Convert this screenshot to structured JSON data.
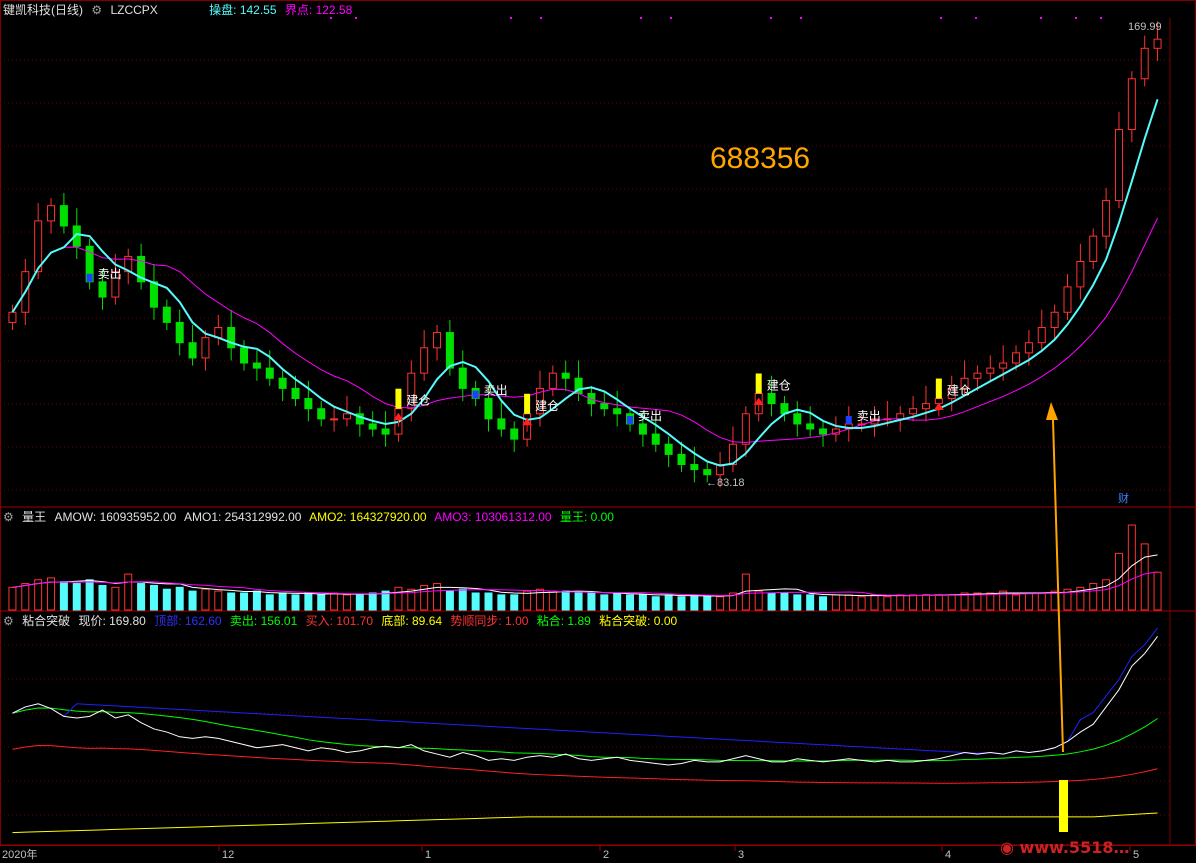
{
  "header": {
    "stock": "键凯科技(日线)",
    "indicator": "LZCCPX",
    "caopan_label": "操盘",
    "caopan_value": "142.55",
    "jiedian_label": "界点",
    "jiedian_value": "122.58"
  },
  "vol_header": {
    "name": "量王",
    "amow": "AMOW: 160935952.00",
    "amo1": "AMO1: 254312992.00",
    "amo2": "AMO2: 164327920.00",
    "amo3": "AMO3: 103061312.00",
    "lw": "量王: 0.00"
  },
  "ind_header": {
    "name": "粘合突破",
    "xj": "现价: 169.80",
    "dingbu": "顶部: 162.60",
    "maichu": "卖出: 156.01",
    "mairu": "买入: 101.70",
    "dibu": "底部: 89.64",
    "shishun": "势顺同步: 1.00",
    "nianhe": "粘合: 1.89",
    "nhtp": "粘合突破: 0.00"
  },
  "annotations": {
    "code": "688356",
    "high_label": "169.99",
    "low_label": "←83.18",
    "cai": "财",
    "signals": [
      {
        "text": "卖出",
        "color": "#00ff00",
        "idx": 6
      },
      {
        "text": "建仓",
        "color": "#ffff00",
        "idx": 30
      },
      {
        "text": "卖出",
        "color": "#00ff00",
        "idx": 36
      },
      {
        "text": "建仓",
        "color": "#ffff00",
        "idx": 40
      },
      {
        "text": "卖出",
        "color": "#00ff00",
        "idx": 48
      },
      {
        "text": "建仓",
        "color": "#ffff00",
        "idx": 58
      },
      {
        "text": "卖出",
        "color": "#00ff00",
        "idx": 65
      },
      {
        "text": "建仓",
        "color": "#ffff00",
        "idx": 72
      }
    ]
  },
  "x_axis": [
    "2020年",
    "12",
    "1",
    "2",
    "3",
    "4",
    "5"
  ],
  "colors": {
    "up": "#ff3232",
    "down": "#54fcfc",
    "greenDown": "#00e000",
    "ma_short": "#54fcfc",
    "ma_long": "#ff00ff"
  },
  "chart_data": {
    "type": "candlestick",
    "y_range": [
      80,
      172
    ],
    "closes": [
      116,
      124,
      134,
      137,
      133,
      129,
      122,
      119,
      124,
      127,
      122,
      117,
      114,
      110,
      107,
      111,
      113,
      109,
      106,
      105,
      103,
      101,
      99,
      97,
      95,
      95,
      96,
      94,
      93,
      92,
      97,
      104,
      109,
      112,
      105,
      101,
      99,
      95,
      93,
      91,
      96,
      101,
      104,
      103,
      100,
      98,
      97,
      96,
      94,
      92,
      90,
      88,
      86,
      85,
      84,
      86,
      90,
      96,
      100,
      98,
      96,
      94,
      93,
      92,
      93,
      94,
      94,
      95,
      95,
      96,
      97,
      98,
      99,
      101,
      103,
      104,
      105,
      106,
      108,
      110,
      113,
      116,
      121,
      126,
      131,
      138,
      152,
      162,
      168,
      169.8
    ],
    "amo_volumes": [
      1.2,
      1.4,
      1.6,
      1.7,
      1.5,
      1.4,
      1.6,
      1.3,
      1.2,
      1.9,
      1.4,
      1.3,
      1.1,
      1.2,
      1.0,
      1.1,
      1.0,
      0.9,
      0.9,
      1.0,
      0.8,
      0.9,
      0.8,
      0.9,
      0.8,
      0.9,
      0.8,
      0.8,
      0.9,
      1.0,
      1.2,
      1.1,
      1.3,
      1.4,
      1.0,
      1.1,
      0.9,
      0.9,
      0.8,
      0.8,
      1.0,
      1.1,
      1.0,
      1.0,
      0.9,
      0.9,
      0.8,
      0.9,
      0.8,
      0.8,
      0.7,
      0.8,
      0.7,
      0.8,
      0.7,
      0.7,
      0.9,
      1.9,
      1.0,
      0.9,
      0.9,
      0.8,
      0.8,
      0.7,
      0.8,
      0.8,
      0.7,
      0.8,
      0.7,
      0.8,
      0.8,
      0.8,
      0.8,
      0.8,
      0.9,
      0.9,
      0.9,
      1.0,
      0.8,
      0.9,
      0.9,
      1.0,
      1.1,
      1.2,
      1.4,
      1.6,
      3.0,
      4.5,
      3.5,
      2.0
    ],
    "white": [
      82,
      86,
      88,
      85,
      80,
      79,
      80,
      84,
      79,
      81,
      76,
      72,
      70,
      67,
      66,
      67,
      66,
      64,
      62,
      60,
      61,
      62,
      60,
      58,
      60,
      59,
      57,
      58,
      60,
      61,
      60,
      62,
      58,
      56,
      54,
      57,
      55,
      52,
      53,
      52,
      54,
      55,
      54,
      56,
      53,
      52,
      53,
      54,
      52,
      51,
      50,
      49,
      50,
      52,
      51,
      51,
      53,
      55,
      53,
      51,
      51,
      53,
      52,
      51,
      52,
      53,
      52,
      51,
      52,
      51,
      51,
      52,
      53,
      55,
      57,
      56,
      57,
      56,
      58,
      57,
      58,
      60,
      64,
      70,
      75,
      86,
      97,
      112,
      120,
      131
    ]
  }
}
